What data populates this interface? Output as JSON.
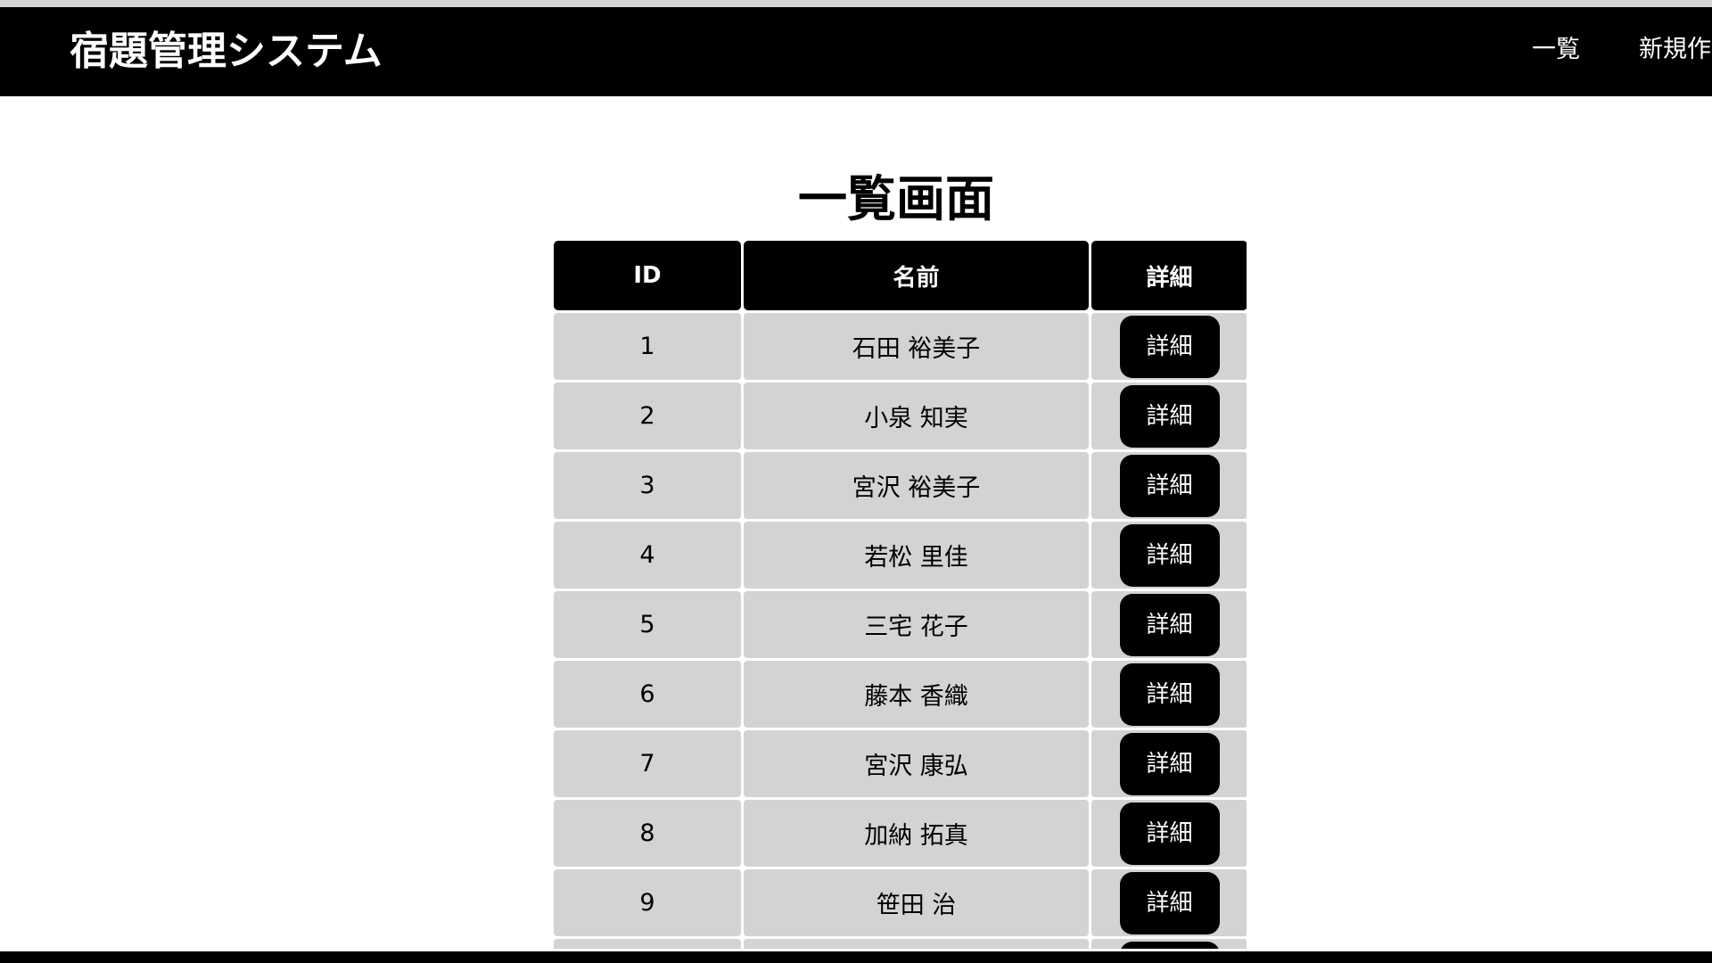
{
  "header": {
    "title": "宿題管理システム",
    "nav": {
      "list_label": "一覧",
      "new_label": "新規作成"
    }
  },
  "main": {
    "page_title": "一覧画面",
    "table": {
      "columns": [
        "ID",
        "名前",
        "詳細"
      ],
      "detail_button_label": "詳細",
      "rows": [
        {
          "id": "1",
          "name": "石田 裕美子"
        },
        {
          "id": "2",
          "name": "小泉 知実"
        },
        {
          "id": "3",
          "name": "宮沢 裕美子"
        },
        {
          "id": "4",
          "name": "若松 里佳"
        },
        {
          "id": "5",
          "name": "三宅 花子"
        },
        {
          "id": "6",
          "name": "藤本 香織"
        },
        {
          "id": "7",
          "name": "宮沢 康弘"
        },
        {
          "id": "8",
          "name": "加納 拓真"
        },
        {
          "id": "9",
          "name": "笹田 治"
        },
        {
          "id": "",
          "name": ""
        }
      ]
    }
  },
  "colors": {
    "header_bg": "#000000",
    "cell_bg": "#d3d3d3",
    "button_bg": "#000000",
    "text_on_dark": "#ffffff"
  }
}
